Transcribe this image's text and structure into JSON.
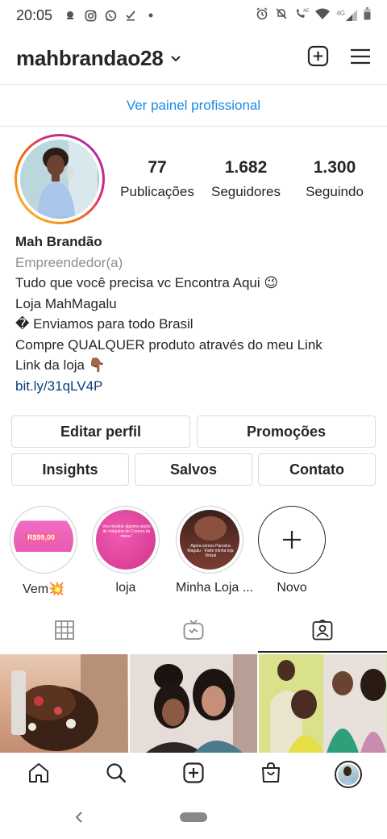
{
  "status_bar": {
    "time": "20:05",
    "left_icons": [
      "notification-icon",
      "instagram-icon",
      "whatsapp-icon",
      "download-icon",
      "dot-icon"
    ],
    "right_icons": [
      "alarm-icon",
      "mute-icon",
      "volte-call-icon",
      "wifi-icon",
      "signal-4g-icon",
      "battery-icon"
    ],
    "network_label": "4G"
  },
  "header": {
    "username": "mahbrandao28",
    "actions": [
      "new-post-icon",
      "menu-icon"
    ]
  },
  "professional_dashboard": {
    "label": "Ver painel profissional",
    "color": "#1a8ae5"
  },
  "profile": {
    "stats": [
      {
        "value": "77",
        "label": "Publicações"
      },
      {
        "value": "1.682",
        "label": "Seguidores"
      },
      {
        "value": "1.300",
        "label": "Seguindo"
      }
    ],
    "name": "Mah Brandão",
    "category": "Empreendedor(a)",
    "bio_lines": [
      "Tudo que você precisa vc Encontra Aqui 😉",
      "Loja MahMagalu",
      "� Enviamos para todo Brasil",
      "Compre QUALQUER produto através do meu Link",
      "Link da loja 👇🏾"
    ],
    "link": "bit.ly/31qLV4P"
  },
  "buttons": {
    "edit_profile": "Editar perfil",
    "promotions": "Promoções",
    "insights": "Insights",
    "saved": "Salvos",
    "contact": "Contato"
  },
  "highlights": [
    {
      "label": "Vem💥",
      "image_text": "R$99,00"
    },
    {
      "label": "loja",
      "image_text": "Vou mostrar alguma opção de máquina de Costura de mesa !"
    },
    {
      "label": "Minha Loja ...",
      "image_text": "Agora somos Parceira Magalu · Visite minha loja Virtual"
    },
    {
      "label": "Novo"
    }
  ],
  "tabs": [
    "grid-icon",
    "igtv-icon",
    "tagged-icon"
  ],
  "active_tab": "tagged",
  "bottom_nav": [
    "home-icon",
    "search-icon",
    "new-post-icon",
    "shop-icon",
    "profile-avatar"
  ],
  "colors": {
    "link_blue": "#1a8ae5",
    "text": "#262626",
    "muted": "#8e8e8e",
    "border": "#dbdbdb"
  }
}
